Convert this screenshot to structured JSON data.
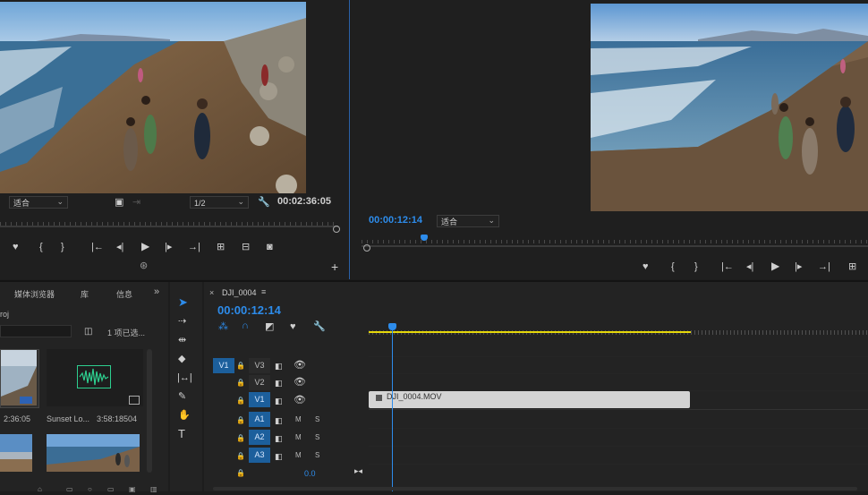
{
  "source_monitor": {
    "fit_label": "适合",
    "resolution_label": "1/2",
    "timecode": "00:02:36:05",
    "buttons": [
      "♥",
      "{",
      "}",
      "|←",
      "◂|",
      "▶",
      "|▸",
      "→|"
    ]
  },
  "program_monitor": {
    "timecode": "00:00:12:14",
    "fit_label": "适合"
  },
  "project_panel": {
    "tabs": [
      "媒体浏览器",
      "库",
      "信息"
    ],
    "more": "»",
    "project_name": "roj",
    "selection_status": "1 项已选...",
    "items": [
      {
        "name": "",
        "duration": "2:36:05"
      },
      {
        "name": "Sunset Lo...",
        "duration": "3:58:18504"
      }
    ]
  },
  "timeline": {
    "sequence_tab": "DJI_0004",
    "timecode": "00:00:12:14",
    "tracks": [
      {
        "target": "V1",
        "name": "V3",
        "type": "video"
      },
      {
        "target": "",
        "name": "V2",
        "type": "video"
      },
      {
        "target": "",
        "name": "V1",
        "type": "video"
      },
      {
        "target": "",
        "name": "A1",
        "type": "audio",
        "m": "M",
        "s": "S"
      },
      {
        "target": "",
        "name": "A2",
        "type": "audio",
        "m": "M",
        "s": "S"
      },
      {
        "target": "",
        "name": "A3",
        "type": "audio",
        "m": "M",
        "s": "S"
      }
    ],
    "master_value": "0.0",
    "clip_name": "DJI_0004.MOV"
  },
  "colors": {
    "accent": "#2d8ceb",
    "work_area": "#e5d70a",
    "clip": "#d4d4d4"
  }
}
